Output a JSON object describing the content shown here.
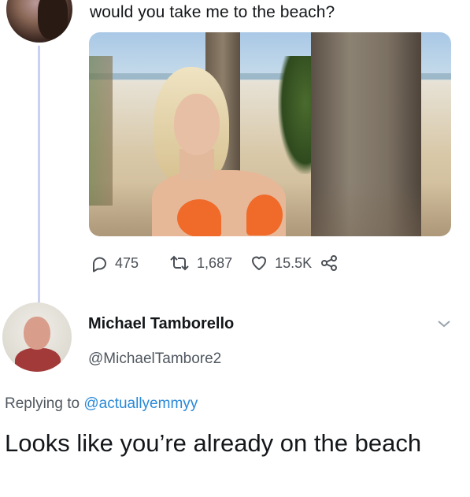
{
  "original_tweet": {
    "text": "would you take me to the beach?",
    "stats": {
      "replies": "475",
      "retweets": "1,687",
      "likes": "15.5K"
    }
  },
  "reply_tweet": {
    "name": "Michael Tamborello",
    "handle": "@MichaelTambore2",
    "replying_prefix": "Replying to",
    "replying_to": "@actuallyemmyy",
    "text": "Looks like you’re already on the beach"
  },
  "colors": {
    "mention": "#2a89d8",
    "thread_line": "#c9d0f0",
    "bikini": "#f06a2a"
  },
  "icons": [
    "reply-icon",
    "retweet-icon",
    "like-icon",
    "share-icon",
    "chevron-down-icon"
  ]
}
